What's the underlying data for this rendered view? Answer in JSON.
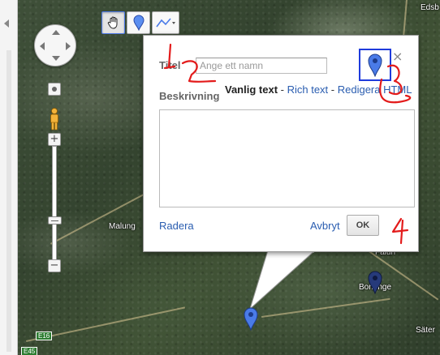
{
  "map": {
    "places": [
      "Malung",
      "Borlänge",
      "Edsb",
      "Säter",
      "Falun"
    ],
    "routes": [
      "E16",
      "E45"
    ]
  },
  "toolbar": {
    "hand_icon": "hand-icon",
    "marker_icon": "marker-icon",
    "line_icon": "line-icon"
  },
  "popup": {
    "title_label": "Titel",
    "title_placeholder": "Ange ett namn",
    "title_value": "",
    "description_label": "Beskrivning",
    "format_current": "Vanlig text",
    "format_sep1": " - ",
    "format_rich": "Rich text",
    "format_sep2": " - ",
    "format_html": "Redigera HTML",
    "description_value": "",
    "delete_label": "Radera",
    "cancel_label": "Avbryt",
    "ok_label": "OK",
    "close_label": "×"
  },
  "annotations": [
    "1",
    "2",
    "3",
    "4"
  ],
  "colors": {
    "link": "#2a5db0",
    "marker_blue": "#4a7be8",
    "annotation_red": "#e31b1b",
    "icon_frame": "#1f3bdc"
  }
}
